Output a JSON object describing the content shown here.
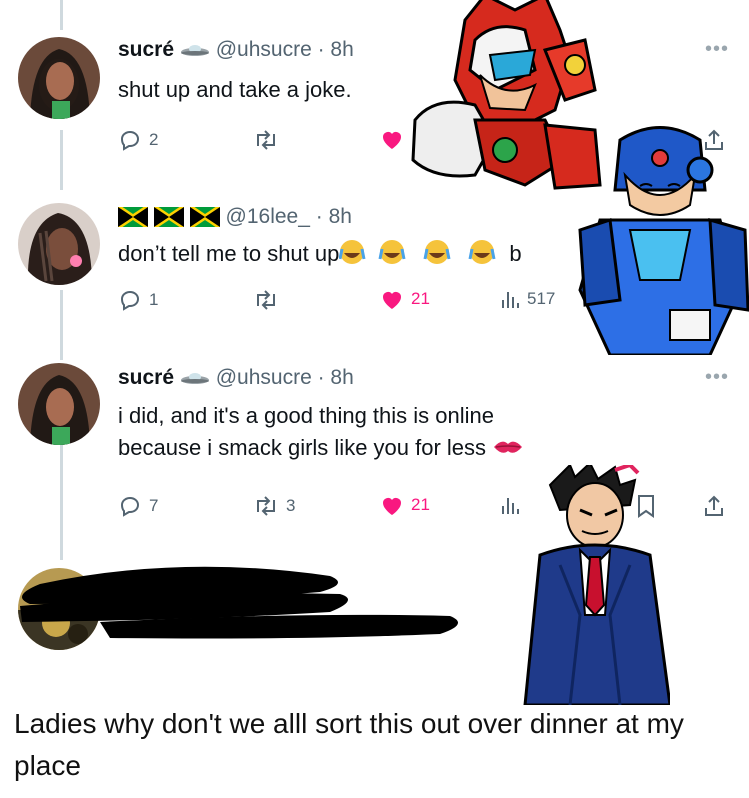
{
  "tweets": [
    {
      "name": "sucré",
      "handle": "@uhsucre",
      "time": "· 8h",
      "text": "shut up and take a joke.",
      "replies": "2"
    },
    {
      "name": "",
      "handle": "@16lee_",
      "time": "· 8h",
      "text": "don’t tell me to shut up",
      "text_tail": "b",
      "replies": "1",
      "likes": "21",
      "views": "517"
    },
    {
      "name": "sucré",
      "handle": "@uhsucre",
      "time": "· 8h",
      "text_line1": "i did, and it's a good thing this is online",
      "text_line2": "because i smack girls like you for less",
      "replies": "7",
      "retweets": "3",
      "likes": "21"
    }
  ],
  "caption": "Ladies why don't we alll sort this out over dinner at my place",
  "icons": {
    "reply": "reply-icon",
    "retweet": "retweet-icon",
    "like": "heart-icon",
    "views": "views-icon",
    "bookmark": "bookmark-icon",
    "share": "share-icon",
    "more": "more-icon"
  },
  "colors": {
    "like_pink": "#f91880",
    "muted_gray": "#536471",
    "thread_line": "#cfd9de"
  }
}
